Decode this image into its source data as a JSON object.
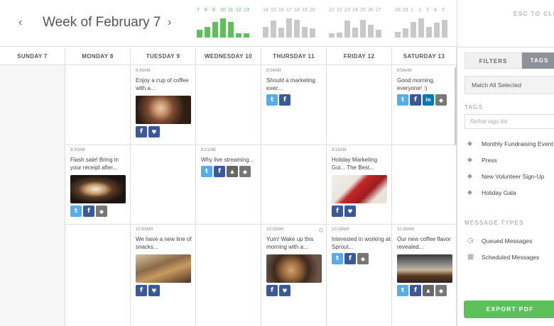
{
  "header": {
    "prev": "‹",
    "title": "Week of February 7",
    "next": "›"
  },
  "sparks": [
    {
      "green": true,
      "nums": [
        "7",
        "8",
        "9",
        "10",
        "11",
        "12",
        "13"
      ],
      "vals": [
        0.4,
        0.55,
        0.8,
        0.95,
        0.8,
        0.2,
        0.2
      ]
    },
    {
      "green": false,
      "nums": [
        "14",
        "15",
        "16",
        "17",
        "18",
        "19",
        "20"
      ],
      "vals": [
        0.55,
        0.85,
        0.5,
        0.95,
        0.9,
        0.55,
        0.45
      ]
    },
    {
      "green": false,
      "nums": [
        "21",
        "22",
        "23",
        "24",
        "25",
        "26",
        "27"
      ],
      "vals": [
        0.2,
        0.25,
        0.85,
        0.5,
        0.9,
        0.65,
        0.4
      ]
    },
    {
      "green": false,
      "nums": [
        "28",
        "29",
        "1",
        "2",
        "3",
        "4",
        "5"
      ],
      "vals": [
        0.3,
        0.45,
        0.8,
        0.95,
        0.55,
        0.75,
        0.9
      ]
    }
  ],
  "days": [
    "SUNDAY 7",
    "MONDAY 8",
    "TUESDAY 9",
    "WEDNESDAY 10",
    "THURSDAY 11",
    "FRIDAY 12",
    "SATURDAY 13"
  ],
  "posts": [
    {
      "col": 2,
      "row": 0,
      "time": "8:43AM",
      "text": "Enjoy a cup of coffee with a...",
      "img": "coffee-girl",
      "icons": [
        "fb",
        "hrt"
      ]
    },
    {
      "col": 4,
      "row": 0,
      "time": "8:04AM",
      "text": "Should a marketing exec...",
      "img": null,
      "icons": [
        "tw",
        "fb"
      ]
    },
    {
      "col": 6,
      "row": 0,
      "time": "8:54AM",
      "text": "Good morning, everyone! :)",
      "img": null,
      "icons": [
        "tw",
        "fb",
        "li",
        "tag"
      ]
    },
    {
      "col": 1,
      "row": 1,
      "time": "9:30AM",
      "text": "Flash sale! Bring in your receipt after...",
      "img": "latte",
      "icons": [
        "tw",
        "fb",
        "tag"
      ]
    },
    {
      "col": 3,
      "row": 1,
      "time": "9:21AM",
      "text": "Why live streaming...",
      "img": null,
      "icons": [
        "tw",
        "fb",
        "gen",
        "tag"
      ]
    },
    {
      "col": 5,
      "row": 1,
      "time": "9:15AM",
      "text": "Holiday Marketing Gui... The Best...",
      "img": "red-sweater",
      "icons": [
        "fb",
        "hrt"
      ]
    },
    {
      "col": 2,
      "row": 2,
      "time": "10:43AM",
      "text": "We have a new line of snacks...",
      "img": "snacks",
      "icons": [
        "fb",
        "hrt"
      ]
    },
    {
      "col": 4,
      "row": 2,
      "time": "10:02AM",
      "text": "Yum! Wake up this morning with a...",
      "img": "pastry",
      "icons": [
        "fb",
        "hrt"
      ],
      "gear": true
    },
    {
      "col": 5,
      "row": 2,
      "time": "10:18AM",
      "text": "Interested in working at Sprout...",
      "img": null,
      "icons": [
        "tw",
        "fb",
        "tag"
      ]
    },
    {
      "col": 6,
      "row": 2,
      "time": "10:30AM",
      "text": "Our new coffee flavor revealed...",
      "img": "espresso",
      "icons": [
        "tw",
        "fb",
        "gen",
        "tag"
      ]
    }
  ],
  "sidebar": {
    "esc": "ESC TO CLOSE",
    "tab_filters": "FILTERS",
    "tab_tags": "TAGS",
    "match": "Match All Selected",
    "tags_label": "TAGS",
    "refine_placeholder": "Refine tags list",
    "tags": [
      "Monthly Fundraising Event",
      "Press",
      "New Volunteer Sign-Up",
      "Holiday Gala"
    ],
    "msg_types_label": "MESSAGE TYPES",
    "msg_types": [
      {
        "label": "Queued Messages",
        "icon": "queued-icon"
      },
      {
        "label": "Scheduled Messages",
        "icon": "scheduled-icon"
      }
    ],
    "export": "EXPORT PDF"
  },
  "colors": {
    "green": "#5cc15a",
    "twitter": "#55acee",
    "facebook": "#3b5998",
    "linkedin": "#0077b5",
    "tab_active": "#8c9298"
  }
}
